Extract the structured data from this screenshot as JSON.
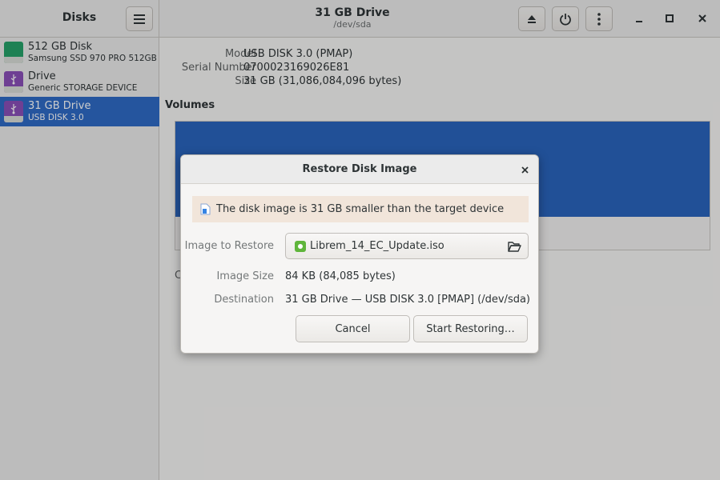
{
  "app": {
    "title": "Disks"
  },
  "header": {
    "title": "31 GB Drive",
    "subtitle": "/dev/sda"
  },
  "icons": {
    "menu": "hamburger-menu-icon",
    "eject": "eject-icon",
    "power": "power-icon",
    "more": "vertical-ellipsis-icon",
    "minimize": "minimize-icon",
    "maximize": "maximize-icon",
    "close": "close-icon"
  },
  "sidebar": {
    "items": [
      {
        "name": "512 GB Disk",
        "subtitle": "Samsung SSD 970 PRO 512GB",
        "icon": "ssd-disk-icon",
        "color": "#26a269",
        "selected": false
      },
      {
        "name": "Drive",
        "subtitle": "Generic STORAGE DEVICE",
        "icon": "usb-drive-icon",
        "color": "#8a4fb8",
        "selected": false
      },
      {
        "name": "31 GB Drive",
        "subtitle": "USB DISK 3.0",
        "icon": "usb-drive-icon",
        "color": "#8a4fb8",
        "selected": true
      }
    ]
  },
  "drive_info": {
    "model_label": "Model",
    "model": "USB DISK 3.0 (PMAP)",
    "serial_label": "Serial Number",
    "serial": "0700023169026E81",
    "size_label": "Size",
    "size": "31 GB (31,086,084,096 bytes)"
  },
  "volumes": {
    "heading": "Volumes",
    "partial_text": "C"
  },
  "dialog": {
    "title": "Restore Disk Image",
    "info_message": "The disk image is 31 GB smaller than the target device",
    "image_label": "Image to Restore",
    "image_file": "Librem_14_EC_Update.iso",
    "image_size_label": "Image Size",
    "image_size": "84 KB (84,085 bytes)",
    "destination_label": "Destination",
    "destination": "31 GB Drive — USB DISK 3.0 [PMAP] (/dev/sda)",
    "cancel_label": "Cancel",
    "start_label": "Start Restoring…"
  },
  "colors": {
    "accent": "#2f6bc6",
    "volume_bar": "#2a64bd",
    "info_bar": "#f1e5da"
  }
}
